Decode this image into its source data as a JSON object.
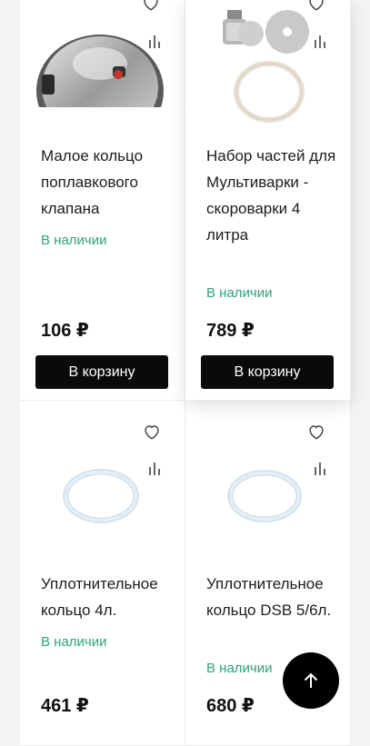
{
  "products": [
    {
      "title": "Малое кольцо поплавкового клапана",
      "stock": "В наличии",
      "price": "106 ₽",
      "cart_label": "В корзину"
    },
    {
      "title": "Набор частей для Мультиварки - скороварки 4 литра",
      "stock": "В наличии",
      "price": "789 ₽",
      "cart_label": "В корзину"
    },
    {
      "title": "Уплотнительное кольцо 4л.",
      "stock": "В наличии",
      "price": "461 ₽"
    },
    {
      "title": "Уплотнительное кольцо DSB 5/6л.",
      "stock": "В наличии",
      "price": "680 ₽"
    }
  ],
  "icons": {
    "favorite": "heart-icon",
    "compare": "compare-bars-icon",
    "scroll_top": "arrow-up-icon"
  },
  "colors": {
    "in_stock": "#2fa37b",
    "cart_button": "#0a0a0a"
  }
}
